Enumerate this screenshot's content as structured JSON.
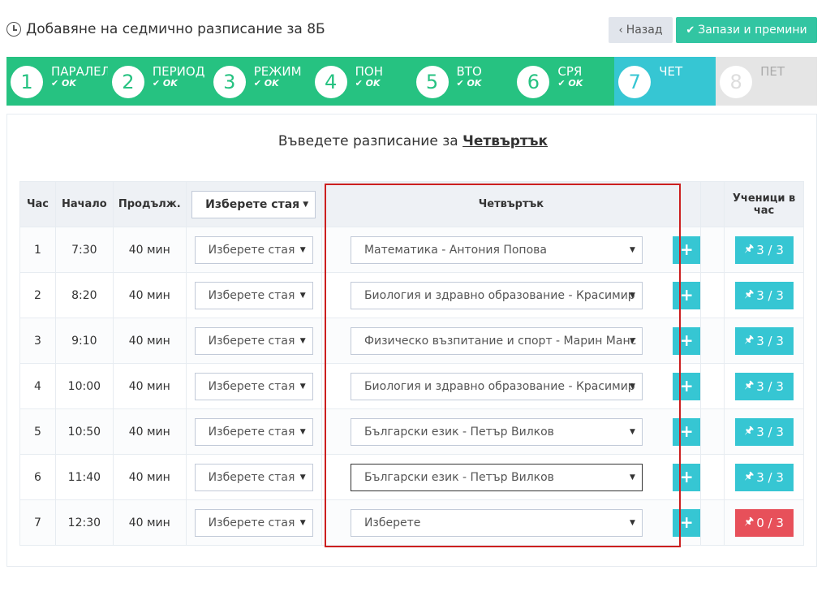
{
  "header": {
    "title": "Добавяне на седмично разписание за 8Б"
  },
  "buttons": {
    "back": "Назад",
    "save": "Запази и премини"
  },
  "wizard": [
    {
      "num": "1",
      "label": "ПАРАЛЕЛ",
      "status": "OK",
      "state": "done"
    },
    {
      "num": "2",
      "label": "ПЕРИОД",
      "status": "OK",
      "state": "done"
    },
    {
      "num": "3",
      "label": "РЕЖИМ",
      "status": "OK",
      "state": "done"
    },
    {
      "num": "4",
      "label": "ПОН",
      "status": "OK",
      "state": "done"
    },
    {
      "num": "5",
      "label": "ВТО",
      "status": "OK",
      "state": "done"
    },
    {
      "num": "6",
      "label": "СРЯ",
      "status": "OK",
      "state": "done"
    },
    {
      "num": "7",
      "label": "ЧЕТ",
      "status": "",
      "state": "active"
    },
    {
      "num": "8",
      "label": "ПЕТ",
      "status": "",
      "state": "todo"
    }
  ],
  "prompt": {
    "text": "Въведете разписание за ",
    "day": "Четвъртък"
  },
  "table": {
    "headers": {
      "hour": "Час",
      "start": "Начало",
      "duration": "Продълж.",
      "room": "Изберете стая",
      "day": "Четвъртък",
      "students": "Ученици в час"
    },
    "rows": [
      {
        "hour": "1",
        "start": "7:30",
        "duration": "40 мин",
        "room": "Изберете стая",
        "subject": "Математика - Антония Попова",
        "students": "3 / 3"
      },
      {
        "hour": "2",
        "start": "8:20",
        "duration": "40 мин",
        "room": "Изберете стая",
        "subject": "Биология и здравно образование - Красимир",
        "students": "3 / 3"
      },
      {
        "hour": "3",
        "start": "9:10",
        "duration": "40 мин",
        "room": "Изберете стая",
        "subject": "Физическо възпитание и спорт - Марин Манс",
        "students": "3 / 3"
      },
      {
        "hour": "4",
        "start": "10:00",
        "duration": "40 мин",
        "room": "Изберете стая",
        "subject": "Биология и здравно образование - Красимир",
        "students": "3 / 3"
      },
      {
        "hour": "5",
        "start": "10:50",
        "duration": "40 мин",
        "room": "Изберете стая",
        "subject": "Български език - Петър Вилков",
        "students": "3 / 3"
      },
      {
        "hour": "6",
        "start": "11:40",
        "duration": "40 мин",
        "room": "Изберете стая",
        "subject": "Български език - Петър Вилков",
        "students": "3 / 3"
      },
      {
        "hour": "7",
        "start": "12:30",
        "duration": "40 мин",
        "room": "Изберете стая",
        "subject": "Изберете",
        "students": "0 / 3"
      }
    ]
  },
  "colors": {
    "done": "#26c281",
    "active": "#36c6d3",
    "todo": "#e5e5e5",
    "badge_ok": "#36c6d3",
    "badge_bad": "#e7505a",
    "highlight": "#cc1f1f"
  }
}
